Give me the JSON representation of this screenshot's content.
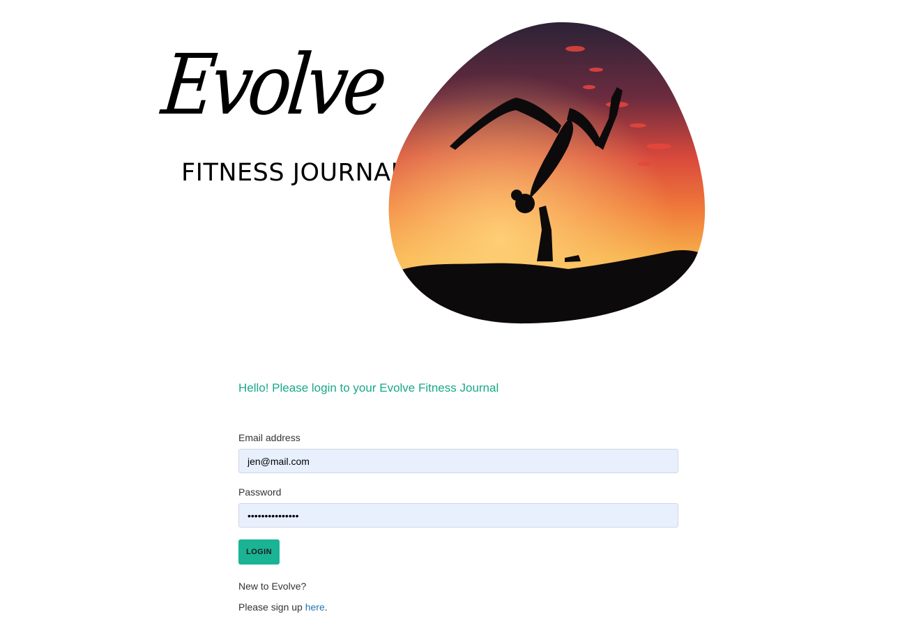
{
  "brand": {
    "logo_script": "Evolve",
    "subtitle": "FITNESS JOURNAL"
  },
  "hero": {
    "image_icon": "yoga-silhouette-sunset-image",
    "colors": {
      "sky_top": "#2c2238",
      "sky_mid": "#e2553f",
      "sky_low": "#f4a23a",
      "silhouette": "#0d0a0c"
    }
  },
  "login": {
    "greeting": "Hello! Please login to your Evolve Fitness Journal",
    "email_label": "Email address",
    "email_value": "jen@mail.com",
    "password_label": "Password",
    "password_value": "•••••••••••••••",
    "submit_label": "LOGIN"
  },
  "signup": {
    "question": "New to Evolve?",
    "prompt_before": "Please sign up ",
    "link_text": "here",
    "prompt_after": "."
  },
  "colors": {
    "accent": "#1ab394",
    "greeting": "#17a88a",
    "link": "#1f74b5",
    "input_bg": "#e8f0fe"
  }
}
